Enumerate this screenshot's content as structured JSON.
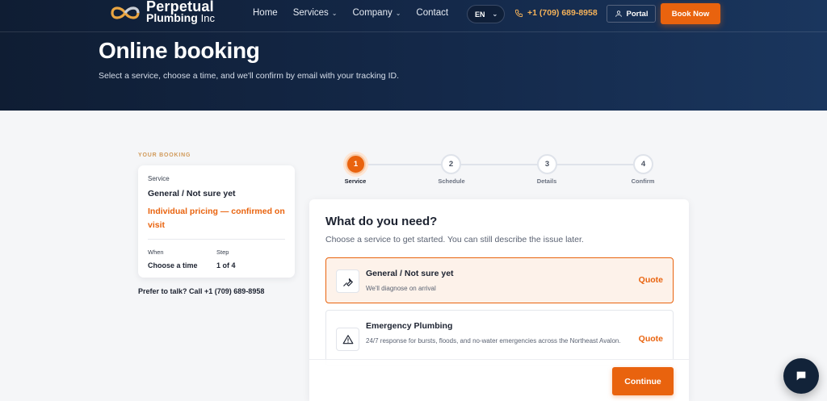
{
  "header": {
    "logo_line1": "Perpetual",
    "logo_line2": "Plumbing",
    "logo_suffix": "Inc",
    "nav": [
      {
        "label": "Home"
      },
      {
        "label": "Services"
      },
      {
        "label": "Company"
      },
      {
        "label": "Contact"
      }
    ],
    "language": "EN",
    "phone": "+1 (709) 689-8958",
    "portal_label": "Portal",
    "book_now_label": "Book Now"
  },
  "hero": {
    "title": "Online booking",
    "subtitle": "Select a service, choose a time, and we'll confirm by email with your tracking ID."
  },
  "sidebar": {
    "section_label": "YOUR BOOKING",
    "service_label": "Service",
    "service_value": "General / Not sure yet",
    "pricing_note": "Individual pricing — confirmed on visit",
    "when_label": "When",
    "when_value": "Choose a time",
    "step_label": "Step",
    "step_value": "1 of 4",
    "talk_text": "Prefer to talk? Call +1 (709) 689-8958"
  },
  "stepper": {
    "steps": [
      {
        "number": "1",
        "label": "Service"
      },
      {
        "number": "2",
        "label": "Schedule"
      },
      {
        "number": "3",
        "label": "Details"
      },
      {
        "number": "4",
        "label": "Confirm"
      }
    ],
    "active_step": 1
  },
  "main": {
    "title": "What do you need?",
    "subtitle": "Choose a service to get started. You can still describe the issue later.",
    "options": [
      {
        "title": "General / Not sure yet",
        "description": "We'll diagnose on arrival",
        "price": "Quote",
        "icon": "wrench-icon",
        "selected": true
      },
      {
        "title": "Emergency Plumbing",
        "description": "24/7 response for bursts, floods, and no-water emergencies across the Northeast Avalon.",
        "price": "Quote",
        "icon": "warning-icon",
        "selected": false
      }
    ],
    "continue_label": "Continue"
  },
  "colors": {
    "accent": "#e9630e",
    "header_bg": "#14294a",
    "page_bg": "#f5f6f8"
  }
}
